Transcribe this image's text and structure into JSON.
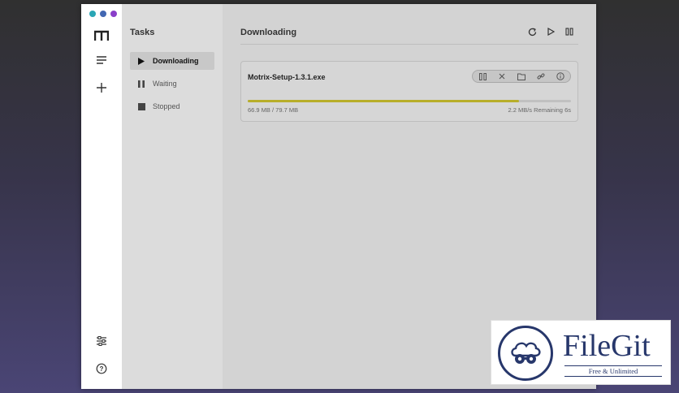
{
  "colors": {
    "light_1": "#2aa6b5",
    "light_2": "#4267b2",
    "light_3": "#8a3fc9",
    "progress": "#b8ae2a",
    "logo": "#27376b"
  },
  "rail": {
    "icons": [
      "motrix-logo-icon",
      "menu-list-icon",
      "add-icon",
      "settings-sliders-icon",
      "help-icon"
    ]
  },
  "tasks_panel": {
    "title": "Tasks",
    "items": [
      {
        "label": "Downloading",
        "icon": "play-icon",
        "active": true
      },
      {
        "label": "Waiting",
        "icon": "pause-icon",
        "active": false
      },
      {
        "label": "Stopped",
        "icon": "stop-icon",
        "active": false
      }
    ]
  },
  "main": {
    "title": "Downloading",
    "header_icons": [
      "refresh-icon",
      "resume-all-icon",
      "pause-all-icon"
    ]
  },
  "task": {
    "filename": "Motrix-Setup-1.3.1.exe",
    "progress_fraction": 0.84,
    "size_text": "66.9 MB / 79.7 MB",
    "speed_text": "2.2 MB/s Remaining 6s",
    "actions": [
      "pause-icon",
      "delete-icon",
      "folder-icon",
      "link-icon",
      "info-icon"
    ]
  },
  "watermark": {
    "name": "FileGit",
    "tagline": "Free & Unlimited"
  }
}
